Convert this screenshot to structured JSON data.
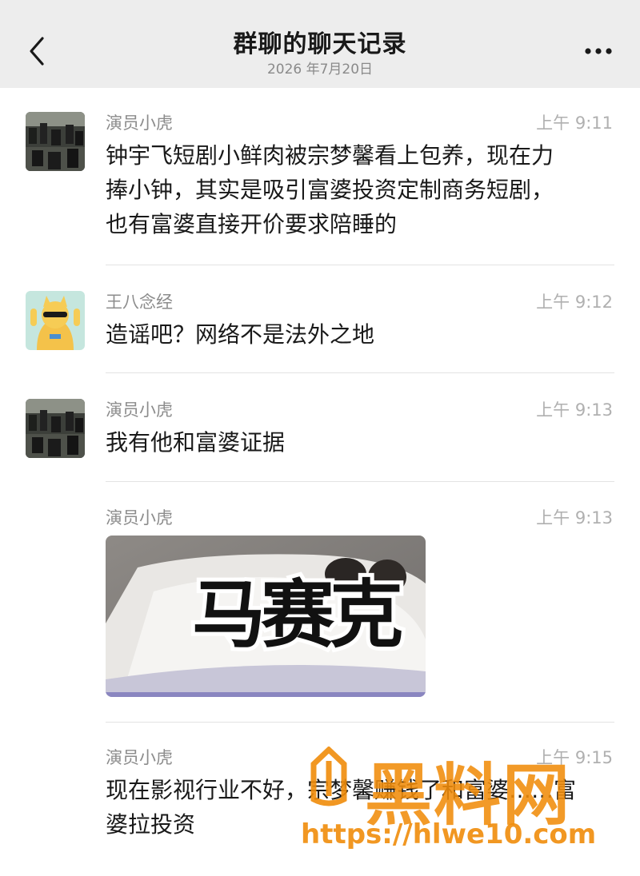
{
  "header": {
    "title": "群聊的聊天记录",
    "date": "2026 年7月20日"
  },
  "messages": [
    {
      "sender": "演员小虎",
      "time": "上午 9:11",
      "text": "钟宇飞短剧小鲜肉被宗梦馨看上包养，现在力捧小钟，其实是吸引富婆投资定制商务短剧，也有富婆直接开价要求陪睡的",
      "lines": [
        "钟宇飞短剧小鲜肉被宗梦馨看上包养，现在力",
        "捧小钟，其实是吸引富婆投资定制商务短剧，",
        "也有富婆直接开价要求陪睡的"
      ]
    },
    {
      "sender": "王八念经",
      "time": "上午 9:12",
      "text": "造谣吧？网络不是法外之地"
    },
    {
      "sender": "演员小虎",
      "time": "上午 9:13",
      "text": "我有他和富婆证据"
    },
    {
      "sender": "演员小虎",
      "time": "上午 9:13",
      "image_overlay": "马赛克"
    },
    {
      "sender": "演员小虎",
      "time": "上午 9:15",
      "lines": [
        "现在影视行业不好，宗梦馨赚钱了和富婆……富",
        "婆拉投资"
      ]
    }
  ],
  "watermark": {
    "brand": "黑料网",
    "url": "https://hlwe10.com"
  },
  "colors": {
    "header_bg": "#ededed",
    "watermark": "#f08c0a"
  }
}
